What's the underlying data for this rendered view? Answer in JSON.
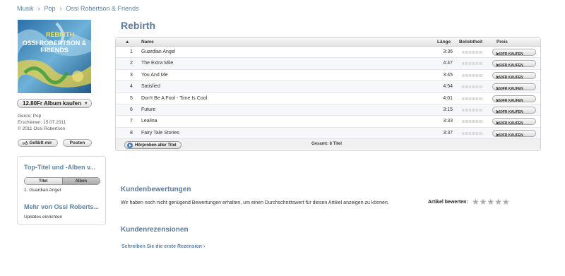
{
  "breadcrumb": {
    "items": [
      "Musik",
      "Pop",
      "Ossi Robertson & Friends"
    ],
    "separator": "›"
  },
  "album": {
    "cover_title": "REBIRTH",
    "cover_artist": "OSSI ROBERTSON & FRIENDS",
    "buy_label": "12.80Fr Album kaufen",
    "genre": "Genre: Pop",
    "released": "Erschienen: 15.07.2011",
    "copyright": "© 2011 Ossi Robertson",
    "like_label": "Gefällt mir",
    "post_label": "Posten"
  },
  "sidebar": {
    "top_header": "Top-Titel und -Alben v...",
    "seg_titles": "Titel",
    "seg_albums": "Alben",
    "top_item": "1. Guardian Angel",
    "more_header": "Mehr von Ossi Roberts...",
    "updates": "Updates einrichten"
  },
  "main": {
    "title": "Rebirth",
    "columns": {
      "sort": "▲",
      "name": "Name",
      "length": "Länge",
      "popularity": "Beliebtheit",
      "price": "Preis"
    },
    "tracks": [
      {
        "num": "1",
        "name": "Guardian Angel",
        "length": "3:36",
        "price": "1.60FR  KAUFEN"
      },
      {
        "num": "2",
        "name": "The Extra Mile",
        "length": "4:47",
        "price": "1.60FR  KAUFEN"
      },
      {
        "num": "3",
        "name": "You And Me",
        "length": "3:45",
        "price": "1.60FR  KAUFEN"
      },
      {
        "num": "4",
        "name": "Satisfied",
        "length": "4:54",
        "price": "1.60FR  KAUFEN"
      },
      {
        "num": "5",
        "name": "Don't Be A Fool - Time Is Cool",
        "length": "4:01",
        "price": "1.60FR  KAUFEN"
      },
      {
        "num": "6",
        "name": "Future",
        "length": "3:15",
        "price": "1.60FR  KAUFEN"
      },
      {
        "num": "7",
        "name": "Lealina",
        "length": "3:33",
        "price": "1.60FR  KAUFEN"
      },
      {
        "num": "8",
        "name": "Fairy Tale Stories",
        "length": "3:37",
        "price": "1.60FR  KAUFEN"
      }
    ],
    "preview_all": "Hörproben aller Titel",
    "total": "Gesamt: 8 Titel"
  },
  "ratings": {
    "header": "Kundenbewertungen",
    "text": "Wir haben noch nicht genügend Bewertungen erhalten, um einen Durchschnittswert für diesen Artikel anzeigen zu können.",
    "rate_label": "Artikel bewerten:",
    "stars": "★★★★★"
  },
  "reviews": {
    "header": "Kundenrezensionen",
    "write_link": "Schreiben Sie die erste Rezension ›"
  },
  "colors": {
    "link": "#5a82a6",
    "heading": "#5b7a99"
  }
}
